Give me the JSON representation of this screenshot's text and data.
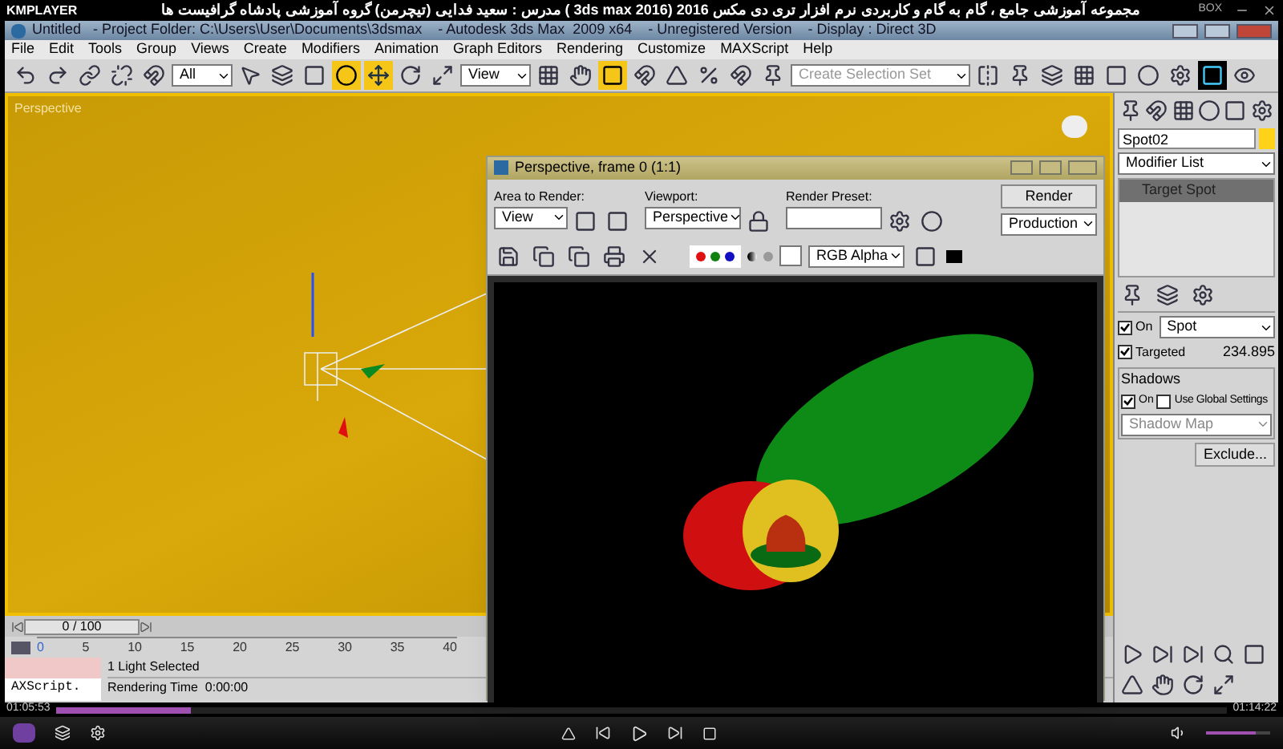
{
  "player": {
    "logo": "KMPLAYER",
    "title": "مجموعه آموزشی جامع ، گام به گام و کاربردی نرم افزار تری دی مکس 2016 (3ds max 2016 )  مدرس : سعید فدایی (تیچرمن) گروه آموزشی پادشاه گرافیست ها",
    "box_label": "BOX",
    "elapsed": "01:05:53",
    "total": "01:14:22",
    "progress": {
      "level": 0.115
    },
    "volume": {
      "level": 0.78
    }
  },
  "max_window": {
    "title": "Untitled   - Project Folder: C:\\Users\\User\\Documents\\3dsmax    - Autodesk 3ds Max  2009 x64    - Unregistered Version    - Display : Direct 3D"
  },
  "menu": [
    "File",
    "Edit",
    "Tools",
    "Group",
    "Views",
    "Create",
    "Modifiers",
    "Animation",
    "Graph Editors",
    "Rendering",
    "Customize",
    "MAXScript",
    "Help"
  ],
  "toolbar": {
    "filter": "All",
    "coordinate_system": "View",
    "selection_set": {
      "placeholder": "Create Selection Set"
    }
  },
  "viewport": {
    "label": "Perspective"
  },
  "render_window": {
    "title": "Perspective, frame 0 (1:1)",
    "area_label": "Area to Render:",
    "area_value": "View",
    "viewport_label": "Viewport:",
    "viewport_value": "Perspective",
    "preset_label": "Render Preset:",
    "render_button": "Render",
    "mode_value": "Production",
    "channel_value": "RGB Alpha",
    "channels": [
      {
        "color": "#e01010",
        "on": true
      },
      {
        "color": "#108010",
        "on": true
      },
      {
        "color": "#1010c0",
        "on": true
      }
    ]
  },
  "command_panel": {
    "object_name": "Spot02",
    "modifier_list": "Modifier List",
    "stack": [
      {
        "label": "Target Spot",
        "selected": true
      }
    ],
    "light_on": {
      "label": "On",
      "checked": true
    },
    "light_type": "Spot",
    "targeted": {
      "label": "Targeted",
      "checked": true
    },
    "target_distance": "234.895",
    "shadows": {
      "title": "Shadows",
      "on": {
        "label": "On",
        "checked": true
      },
      "global": {
        "label": "Use Global Settings",
        "checked": false
      },
      "type": "Shadow Map",
      "exclude": "Exclude..."
    }
  },
  "timeline": {
    "slider": "0 / 100",
    "ticks": [
      "0",
      "5",
      "10",
      "15",
      "20",
      "25",
      "30",
      "35",
      "40"
    ]
  },
  "status": {
    "selection": "1 Light Selected",
    "render_time": "Rendering Time  0:00:00",
    "listener": "AXScript."
  }
}
